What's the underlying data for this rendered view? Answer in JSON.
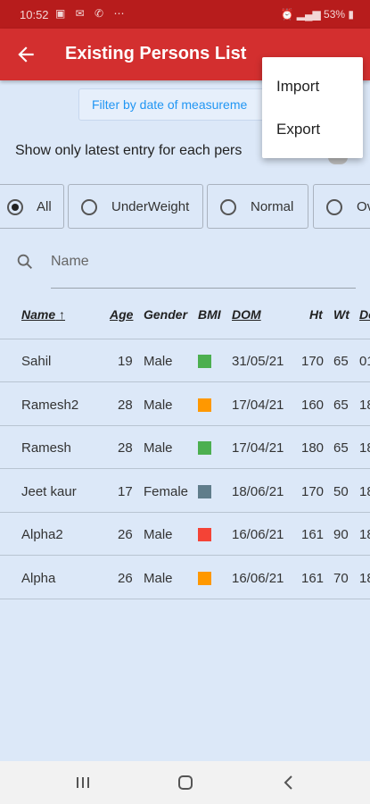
{
  "status_bar": {
    "time": "10:52",
    "battery": "53%"
  },
  "appbar": {
    "title": "Existing Persons List"
  },
  "menu": {
    "items": [
      "Import",
      "Export"
    ]
  },
  "filter": {
    "label": "Filter by date of measureme"
  },
  "latest": {
    "label": "Show only latest entry for each pers"
  },
  "chips": [
    {
      "label": "All",
      "selected": true
    },
    {
      "label": "UnderWeight",
      "selected": false
    },
    {
      "label": "Normal",
      "selected": false
    },
    {
      "label": "Ov",
      "selected": false
    }
  ],
  "search": {
    "placeholder": "Name"
  },
  "table": {
    "headers": {
      "name": "Name",
      "age": "Age",
      "gender": "Gender",
      "bmi": "BMI",
      "dom": "DOM",
      "ht": "Ht",
      "wt": "Wt",
      "dob": "Do"
    },
    "rows": [
      {
        "name": "Sahil",
        "age": "19",
        "gender": "Male",
        "bmi_color": "#4caf50",
        "dom": "31/05/21",
        "ht": "170",
        "wt": "65",
        "dob": "01"
      },
      {
        "name": "Ramesh2",
        "age": "28",
        "gender": "Male",
        "bmi_color": "#ff9800",
        "dom": "17/04/21",
        "ht": "160",
        "wt": "65",
        "dob": "18"
      },
      {
        "name": "Ramesh",
        "age": "28",
        "gender": "Male",
        "bmi_color": "#4caf50",
        "dom": "17/04/21",
        "ht": "180",
        "wt": "65",
        "dob": "18"
      },
      {
        "name": "Jeet kaur",
        "age": "17",
        "gender": "Female",
        "bmi_color": "#607d8b",
        "dom": "18/06/21",
        "ht": "170",
        "wt": "50",
        "dob": "18"
      },
      {
        "name": "Alpha2",
        "age": "26",
        "gender": "Male",
        "bmi_color": "#f44336",
        "dom": "16/06/21",
        "ht": "161",
        "wt": "90",
        "dob": "18"
      },
      {
        "name": "Alpha",
        "age": "26",
        "gender": "Male",
        "bmi_color": "#ff9800",
        "dom": "16/06/21",
        "ht": "161",
        "wt": "70",
        "dob": "18"
      }
    ]
  },
  "colors": {
    "appbar": "#d32f2f",
    "status_bar": "#b71c1c",
    "background": "#dce8f8",
    "link": "#2196f3"
  }
}
